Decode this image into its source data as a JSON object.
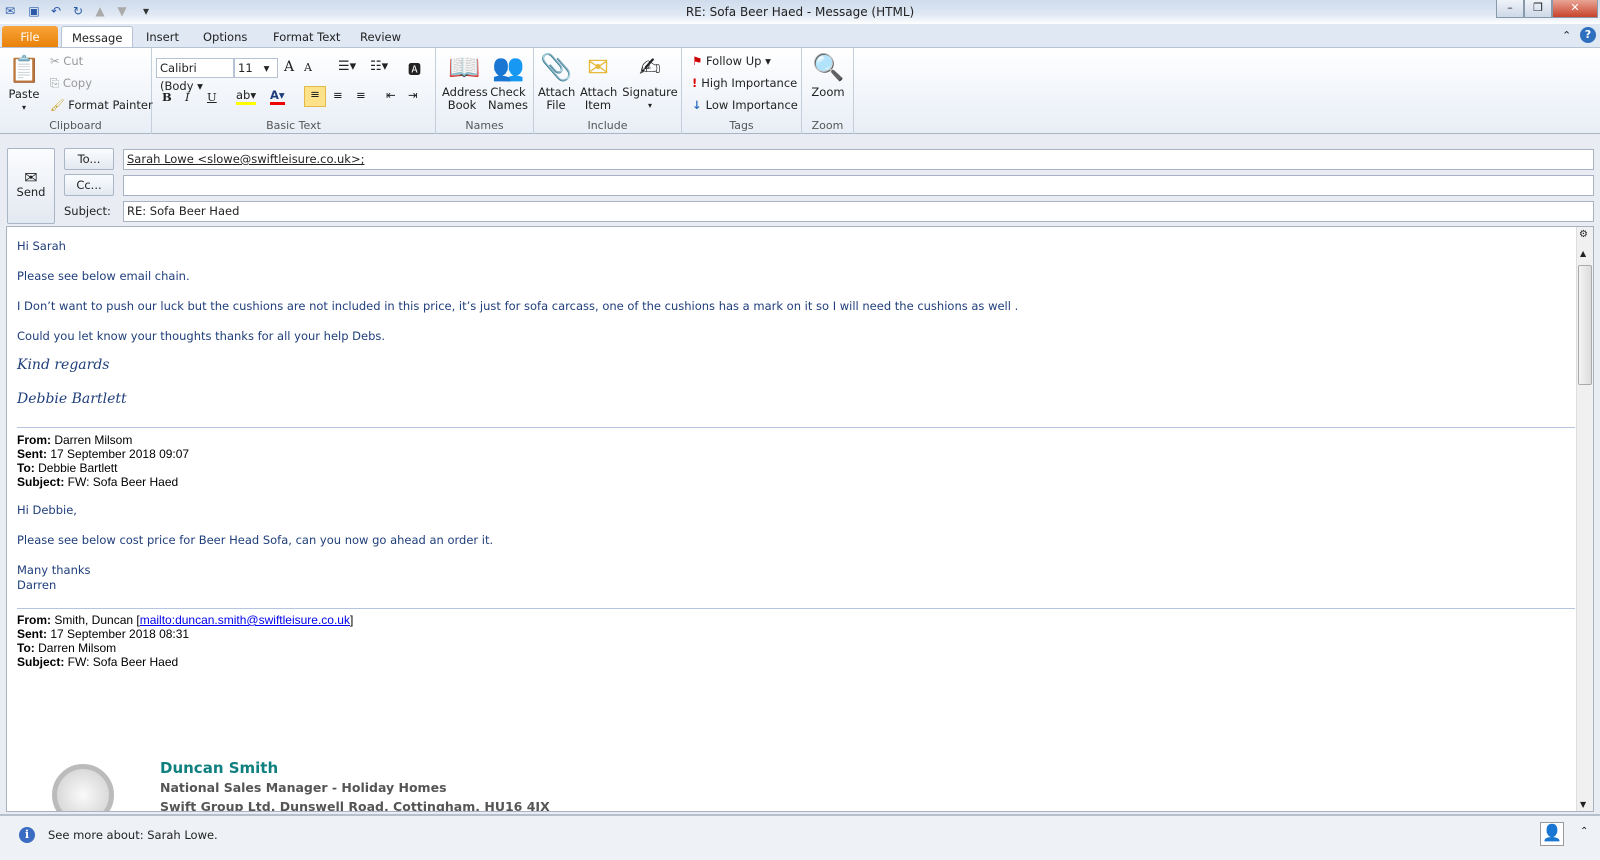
{
  "window": {
    "title": "RE: Sofa Beer Haed  -  Message (HTML)",
    "min": "–",
    "restore": "❐",
    "close": "✕"
  },
  "quick_access": [
    "save-icon",
    "undo-icon",
    "redo-icon",
    "up-icon",
    "down-icon",
    "customize-icon"
  ],
  "tabs": [
    {
      "label": "File"
    },
    {
      "label": "Message"
    },
    {
      "label": "Insert"
    },
    {
      "label": "Options"
    },
    {
      "label": "Format Text"
    },
    {
      "label": "Review"
    }
  ],
  "ribbon": {
    "clipboard": {
      "label": "Clipboard",
      "paste": "Paste",
      "cut": "Cut",
      "copy": "Copy",
      "format_painter": "Format Painter"
    },
    "basic_text": {
      "label": "Basic Text",
      "font": "Calibri (Body",
      "size": "11",
      "bold": "B",
      "italic": "I",
      "underline": "U"
    },
    "names": {
      "label": "Names",
      "address_book": "Address Book",
      "check_names": "Check Names"
    },
    "include": {
      "label": "Include",
      "attach_file": "Attach File",
      "attach_item": "Attach Item",
      "signature": "Signature"
    },
    "tags": {
      "label": "Tags",
      "follow_up": "Follow Up",
      "high": "High Importance",
      "low": "Low Importance"
    },
    "zoom": {
      "label": "Zoom",
      "zoom": "Zoom"
    }
  },
  "compose": {
    "send": "Send",
    "to_btn": "To...",
    "cc_btn": "Cc...",
    "subject_label": "Subject:",
    "to_value": "Sarah Lowe <slowe@swiftleisure.co.uk>;",
    "cc_value": "",
    "subject_value": "RE: Sofa Beer Haed"
  },
  "body": {
    "p1": "Hi Sarah",
    "p2": "Please see below email chain.",
    "p3": "I Don’t want to push our luck but the cushions are not included in this price, it’s just for sofa carcass, one of the cushions has a mark on it so I  will need the cushions as well .",
    "p4": "Could you let know your thoughts thanks for all your help Debs.",
    "sign1": "Kind regards",
    "sign2": "Debbie Bartlett",
    "m1": {
      "from_l": "From:",
      "from": " Darren Milsom",
      "sent_l": "Sent:",
      "sent": " 17 September 2018 09:07",
      "to_l": "To:",
      "to": " Debbie Bartlett",
      "subj_l": "Subject:",
      "subj": " FW: Sofa Beer Haed"
    },
    "m1_greet": "Hi Debbie,",
    "m1_text": "Please see below cost price for Beer Head Sofa, can you now go ahead an order it.",
    "m1_thanks": "Many thanks",
    "m1_name": "Darren",
    "m2": {
      "from_l": "From:",
      "from": " Smith, Duncan [",
      "mailto": "mailto:duncan.smith@swiftleisure.co.uk",
      "from_end": "]",
      "sent_l": "Sent:",
      "sent": " 17 September 2018 08:31",
      "to_l": "To:",
      "to": " Darren Milsom",
      "subj_l": "Subject:",
      "subj": " FW: Sofa Beer Haed"
    },
    "sig_name": "Duncan Smith",
    "sig_title": "National Sales Manager - Holiday Homes",
    "sig_addr": "Swift Group Ltd, Dunswell Road, Cottingham, HU16 4JX"
  },
  "status": {
    "text": "See more about: Sarah Lowe."
  },
  "colors": {
    "file_tab": "#e97f06",
    "body_text": "#1f3e7a",
    "sig_name": "#0f7f7f"
  }
}
